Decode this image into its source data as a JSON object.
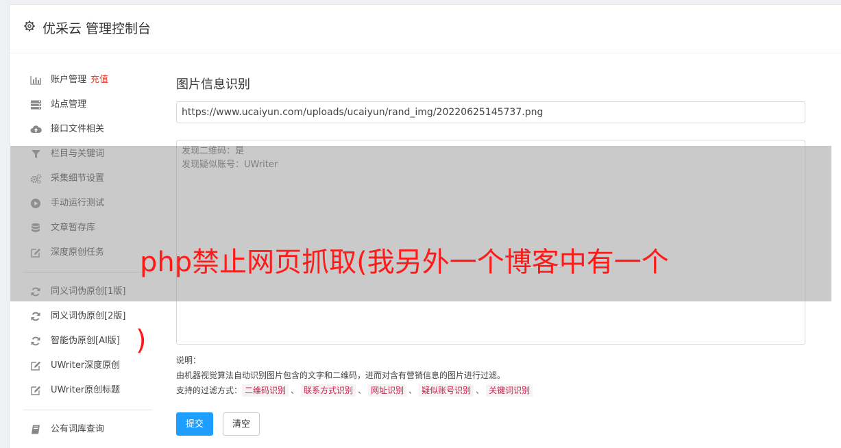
{
  "header": {
    "title": "优采云 管理控制台",
    "icon": "gear-icon"
  },
  "sidebar": {
    "items": [
      {
        "label": "账户管理",
        "badge": "充值",
        "icon": "bar-chart-icon"
      },
      {
        "label": "站点管理",
        "icon": "server-icon"
      },
      {
        "label": "接口文件相关",
        "icon": "cloud-upload-icon"
      },
      {
        "label": "栏目与关键词",
        "icon": "filter-icon"
      },
      {
        "label": "采集细节设置",
        "icon": "cogs-icon"
      },
      {
        "label": "手动运行测试",
        "icon": "play-icon"
      },
      {
        "label": "文章暂存库",
        "icon": "database-icon"
      },
      {
        "label": "深度原创任务",
        "icon": "edit-icon"
      },
      {
        "label": "同义词伪原创[1版]",
        "icon": "refresh-icon"
      },
      {
        "label": "同义词伪原创[2版]",
        "icon": "refresh-icon"
      },
      {
        "label": "智能伪原创[AI版]",
        "icon": "refresh-icon"
      },
      {
        "label": "UWriter深度原创",
        "icon": "edit-icon"
      },
      {
        "label": "UWriter原创标题",
        "icon": "edit-icon"
      },
      {
        "label": "公有词库查询",
        "icon": "book-icon"
      }
    ]
  },
  "main": {
    "title": "图片信息识别",
    "url_value": "https://www.ucaiyun.com/uploads/ucaiyun/rand_img/20220625145737.png",
    "result_lines": [
      "发现二维码：是",
      "发现疑似账号：UWriter"
    ],
    "notes": {
      "heading": "说明：",
      "description": "由机器视觉算法自动识别图片包含的文字和二维码，进而对含有营销信息的图片进行过滤。",
      "filter_label": "支持的过滤方式：",
      "filters": [
        "二维码识别",
        "联系方式识别",
        "网址识别",
        "疑似账号识别",
        "关键词识别"
      ],
      "separator": "、"
    },
    "submit_label": "提交",
    "clear_label": "清空"
  },
  "overlay": {
    "text": "php禁止网页抓取(我另外一个博客中有一个",
    "paren": ")"
  },
  "colors": {
    "accent": "#1e9fff",
    "badge": "#e03c31",
    "tag_text": "#c7254e",
    "overlay_text": "#ff1a1a"
  }
}
